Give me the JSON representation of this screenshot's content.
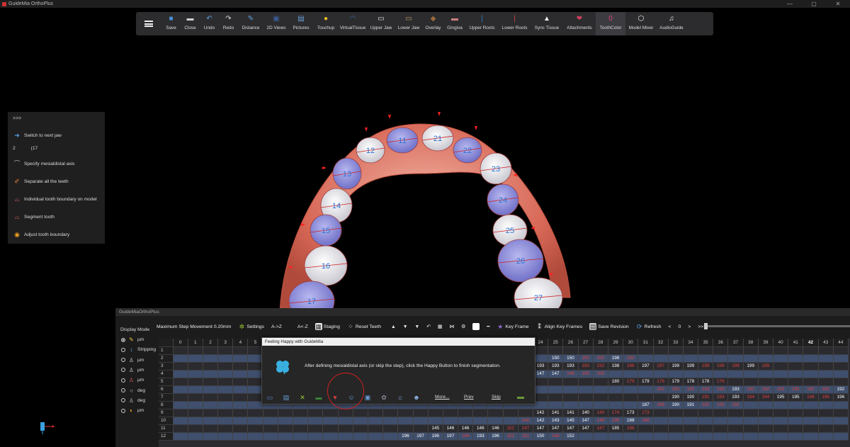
{
  "window": {
    "title": "GuideMia OrthoPlus",
    "controls": [
      "—",
      "▢",
      "✕"
    ]
  },
  "toolbar": {
    "items": [
      {
        "label": "Save",
        "icon": "save-icon",
        "color": "#4a90d9"
      },
      {
        "label": "Close",
        "icon": "close-file-icon",
        "color": "#cfcfcf"
      },
      {
        "label": "Undo",
        "icon": "undo-icon",
        "color": "#5aa0e0"
      },
      {
        "label": "Redo",
        "icon": "redo-icon",
        "color": "#dddddd"
      },
      {
        "label": "Distance",
        "icon": "ruler-icon",
        "color": "#5aa0e0"
      },
      {
        "label": "2D Views",
        "icon": "2d-views-icon",
        "color": "#3b5b9a"
      },
      {
        "label": "Pictures",
        "icon": "pictures-icon",
        "color": "#6aa0d8"
      },
      {
        "label": "Touchup",
        "icon": "touchup-icon",
        "color": "#f0c020"
      },
      {
        "label": "VirtualTissue",
        "icon": "virtual-tissue-icon",
        "color": "#3a6ab0"
      },
      {
        "label": "Upper Jaw",
        "icon": "upper-jaw-icon",
        "color": "#e8e8e8"
      },
      {
        "label": "Lower Jaw",
        "icon": "lower-jaw-icon",
        "color": "#c8a070"
      },
      {
        "label": "Overlay",
        "icon": "overlay-icon",
        "color": "#9a6a3a"
      },
      {
        "label": "Gingiva",
        "icon": "gingiva-icon",
        "color": "#d08080"
      },
      {
        "label": "Upper Roots",
        "icon": "upper-roots-icon",
        "color": "#2a7ad0"
      },
      {
        "label": "Lower Roots",
        "icon": "lower-roots-icon",
        "color": "#d04040"
      },
      {
        "label": "Sync Tissue",
        "icon": "sync-tissue-icon",
        "color": "#eeeeee"
      },
      {
        "label": "Attachments",
        "icon": "attachments-icon",
        "color": "#d04060"
      },
      {
        "label": "ToothColor",
        "icon": "tooth-color-icon",
        "color": "#e04080"
      },
      {
        "label": "Model Mixer",
        "icon": "model-mixer-icon",
        "color": "#eeeeee"
      },
      {
        "label": "AudioGuide",
        "icon": "audio-guide-icon",
        "color": "#eeeeee"
      }
    ]
  },
  "left_panel": {
    "collapse": ">>>",
    "switch_jaw": "Switch to next jaw",
    "step_number": "2",
    "step_combo": "(17",
    "steps": [
      {
        "label": "Specify mesialdistal axis",
        "icon": "mesialdistal-axis-icon"
      },
      {
        "label": "Separate all the teeth",
        "icon": "separate-teeth-icon"
      },
      {
        "label": "Individual tooth boundary on model",
        "icon": "tooth-boundary-icon"
      },
      {
        "label": "Segment tooth",
        "icon": "segment-tooth-icon"
      },
      {
        "label": "Adjust tooth boundary",
        "icon": "adjust-boundary-icon"
      }
    ]
  },
  "teeth_labels": [
    "11",
    "21",
    "12",
    "22",
    "13",
    "23",
    "14",
    "24",
    "15",
    "25",
    "16",
    "26",
    "17",
    "27"
  ],
  "bottom_panel": {
    "title": "GuideMiaOrthoPlus",
    "display_mode_label": "Display Mode",
    "display_modes": [
      {
        "label": "µm",
        "selected": true
      },
      {
        "label": "Stripping",
        "selected": false
      },
      {
        "label": "µm",
        "selected": false
      },
      {
        "label": "µm",
        "selected": false
      },
      {
        "label": "µm",
        "selected": false
      },
      {
        "label": "deg",
        "selected": false
      },
      {
        "label": "deg",
        "selected": false
      },
      {
        "label": "µm",
        "selected": false
      }
    ],
    "toolbar": {
      "max_step": "Maximum Step Movement  0.20mm",
      "settings": "Settings",
      "a_z": "A->Z",
      "a_z_rev": "A<-Z",
      "staging": "Staging",
      "reset": "Reset Teeth",
      "key_frame": "Key Frame",
      "align_key_frames": "Align Key Frames",
      "save_revision": "Save Revision",
      "refresh": "Refresh",
      "prev_arrow": "<",
      "frame_value": "0",
      "next_arrow": ">",
      "last_arrow": ">>"
    },
    "grid": {
      "columns": [
        "0",
        "1",
        "2",
        "3",
        "4",
        "5",
        "",
        "",
        "",
        "",
        "",
        "",
        "",
        "",
        "",
        "",
        "",
        "",
        "",
        "",
        "",
        "",
        "",
        "",
        "24",
        "25",
        "26",
        "27",
        "28",
        "29",
        "30",
        "31",
        "32",
        "33",
        "34",
        "35",
        "36",
        "37",
        "38",
        "39",
        "40",
        "41",
        "42",
        "43",
        "44"
      ],
      "bold_column": "42",
      "rows": [
        {
          "label": "1",
          "cells": {}
        },
        {
          "label": "2",
          "cells": {
            "25": "150",
            "26": "150",
            "27": "150",
            "28": "150",
            "29": "198",
            "30": "193"
          }
        },
        {
          "label": "3",
          "cells": {
            "24": "193",
            "25": "193",
            "26": "193",
            "27": "193",
            "28": "232",
            "29": "198",
            "30": "196",
            "31": "197",
            "32": "197",
            "33": "199",
            "34": "199",
            "35": "199",
            "36": "199",
            "37": "199",
            "38": "199",
            "39": "199"
          }
        },
        {
          "label": "4",
          "cells": {
            "24": "147",
            "25": "147",
            "26": "146",
            "27": "155",
            "28": "155"
          }
        },
        {
          "label": "5",
          "cells": {
            "29": "180",
            "30": "179",
            "31": "179",
            "32": "176",
            "33": "179",
            "34": "178",
            "35": "178",
            "36": "176"
          }
        },
        {
          "label": "6",
          "cells": {
            "32": "192",
            "33": "193",
            "34": "193",
            "35": "193",
            "36": "193",
            "37": "193",
            "38": "192",
            "39": "192",
            "40": "192",
            "41": "192",
            "42": "192",
            "43": "192",
            "44": "192"
          }
        },
        {
          "label": "7",
          "cells": {
            "33": "190",
            "34": "190",
            "35": "191",
            "36": "193",
            "37": "193",
            "38": "194",
            "39": "194",
            "40": "195",
            "41": "195",
            "42": "196",
            "43": "196",
            "44": "196"
          }
        },
        {
          "label": "8",
          "cells": {
            "31": "187",
            "32": "188",
            "33": "190",
            "34": "191",
            "35": "192",
            "36": "192",
            "37": "192"
          }
        },
        {
          "label": "9",
          "cells": {
            "24": "142",
            "25": "141",
            "26": "141",
            "27": "140",
            "28": "140",
            "29": "174",
            "30": "173",
            "31": "173"
          }
        },
        {
          "label": "10",
          "cells": {
            "23": "140",
            "24": "142",
            "25": "143",
            "26": "145",
            "27": "147",
            "28": "146",
            "29": "196",
            "30": "188",
            "31": "188"
          }
        },
        {
          "label": "11",
          "cells": {
            "17": "145",
            "18": "146",
            "19": "146",
            "20": "146",
            "21": "146",
            "22": "152",
            "23": "147",
            "24": "147",
            "25": "147",
            "26": "147",
            "27": "147",
            "28": "147",
            "29": "185",
            "30": "186"
          }
        },
        {
          "label": "12",
          "cells": {
            "15": "196",
            "16": "197",
            "17": "196",
            "18": "197",
            "19": "194",
            "20": "193",
            "21": "196",
            "22": "152",
            "23": "151",
            "24": "150",
            "25": "149",
            "26": "152"
          }
        }
      ],
      "red_cells": {
        "2": [
          "27",
          "28",
          "30"
        ],
        "3": [
          "27",
          "28",
          "30",
          "32",
          "35",
          "36",
          "37",
          "39"
        ],
        "4": [
          "26",
          "27",
          "28"
        ],
        "5": [
          "30",
          "32",
          "36"
        ],
        "6": [
          "32",
          "33",
          "34",
          "35",
          "36",
          "38",
          "39",
          "40",
          "41",
          "42",
          "43"
        ],
        "7": [
          "35",
          "36",
          "38",
          "39",
          "42",
          "43"
        ],
        "8": [
          "32",
          "35",
          "36",
          "37"
        ],
        "9": [
          "28",
          "29",
          "31"
        ],
        "10": [
          "23",
          "28",
          "29",
          "31"
        ],
        "11": [
          "22",
          "23",
          "28",
          "30"
        ],
        "12": [
          "19",
          "22",
          "23",
          "25"
        ]
      }
    }
  },
  "dialog": {
    "title": "Feeling Happy with GuideMia",
    "message": "After defining mesialdistal axis (or skip the step), click the Happy Button to finish segmentation.",
    "more": "More...",
    "prev": "Prev",
    "skip": "Skip",
    "icons": [
      {
        "name": "axis-tool-icon",
        "glyph": "▭",
        "color": "#5a8ad0"
      },
      {
        "name": "save-step-icon",
        "glyph": "▤",
        "color": "#6aa0d8"
      },
      {
        "name": "tools-icon",
        "glyph": "✕",
        "color": "#9acd32"
      },
      {
        "name": "jaw-model-icon",
        "glyph": "▬",
        "color": "#3a8a3a"
      },
      {
        "name": "tooth-red-icon",
        "glyph": "♥",
        "color": "#d04040"
      },
      {
        "name": "happy-button-icon",
        "glyph": "☺",
        "color": "#6aa0d8"
      },
      {
        "name": "monitor-icon",
        "glyph": "▣",
        "color": "#6aa0d8"
      },
      {
        "name": "gear-tooth-icon",
        "glyph": "✿",
        "color": "#8a8a9a"
      },
      {
        "name": "bank-icon",
        "glyph": "⌂",
        "color": "#8ab0e0"
      },
      {
        "name": "users-icon",
        "glyph": "☻",
        "color": "#8ab0e0"
      }
    ],
    "finish_icon": {
      "name": "finish-icon",
      "glyph": "▬",
      "color": "#6a9a3a"
    }
  }
}
